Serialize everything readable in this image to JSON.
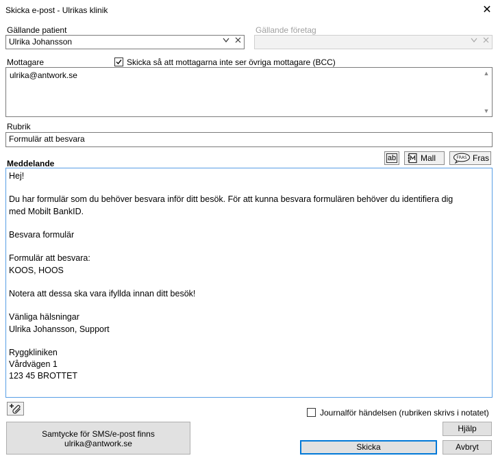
{
  "window": {
    "title": "Skicka e-post - Ulrikas klinik",
    "close_glyph": "✕"
  },
  "patient": {
    "label": "Gällande patient",
    "value": "Ulrika Johansson"
  },
  "company": {
    "label": "Gällande företag",
    "value": ""
  },
  "recipients": {
    "label": "Mottagare",
    "bcc_label": "Skicka så att mottagarna inte ser övriga mottagare (BCC)",
    "bcc_checked": true,
    "value": "ulrika@antwork.se"
  },
  "subject": {
    "label": "Rubrik",
    "value": "Formulär att besvara"
  },
  "message": {
    "label": "Meddelande",
    "toolbar": {
      "ab_label": "ab",
      "mall_label": "Mall",
      "fras_label": "Fras",
      "fras_icon_text": "FRAS"
    },
    "lines": [
      "Hej!",
      "",
      "Du har formulär som du behöver besvara inför ditt besök. För att kunna besvara formulären behöver du identifiera dig",
      "med Mobilt BankID.",
      "",
      "Besvara formulär",
      "",
      "Formulär att besvara:",
      "KOOS, HOOS",
      "",
      "Notera att dessa ska vara ifyllda innan ditt besök!",
      "",
      "Vänliga hälsningar",
      "Ulrika Johansson, Support",
      "",
      "Ryggkliniken",
      "Vårdvägen 1",
      "123 45 BROTTET"
    ]
  },
  "journal": {
    "label": "Journalför händelsen (rubriken skrivs i notatet)",
    "checked": false
  },
  "consent": {
    "line1": "Samtycke för SMS/e-post finns",
    "line2": "ulrika@antwork.se"
  },
  "buttons": {
    "help": "Hjälp",
    "send": "Skicka",
    "cancel": "Avbryt"
  },
  "colors": {
    "focus_border": "#569de5",
    "default_button_border": "#0078d7",
    "disabled_text": "#a0a0a0"
  }
}
